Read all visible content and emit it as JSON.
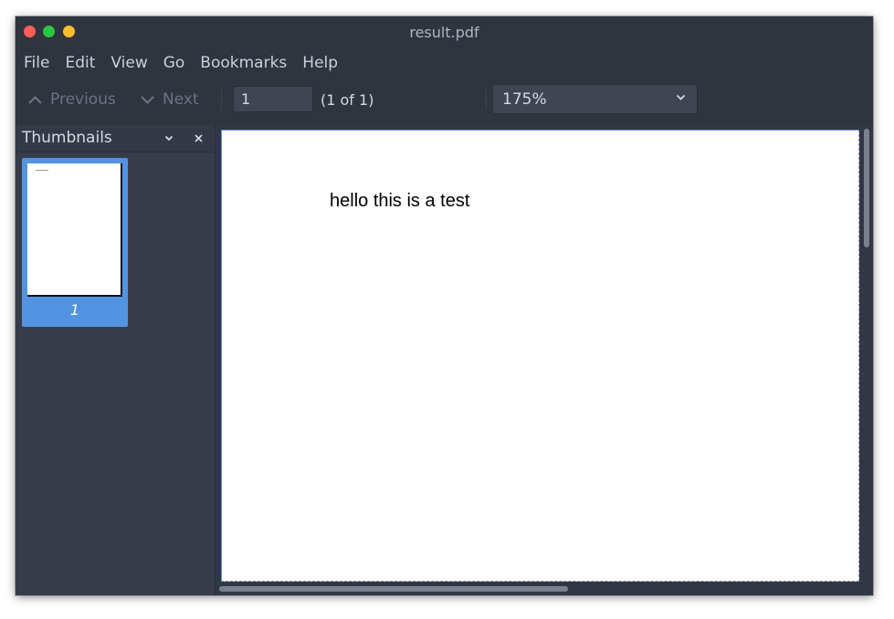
{
  "window": {
    "title": "result.pdf"
  },
  "menu": [
    "File",
    "Edit",
    "View",
    "Go",
    "Bookmarks",
    "Help"
  ],
  "toolbar": {
    "previous_label": "Previous",
    "next_label": "Next",
    "page_value": "1",
    "page_count": "(1 of 1)",
    "zoom_value": "175%"
  },
  "sidebar": {
    "title": "Thumbnails",
    "thumbnails": [
      {
        "label": "1"
      }
    ]
  },
  "document": {
    "text": "hello this is a test"
  },
  "colors": {
    "window_bg": "#2f343f",
    "accent": "#5294e2",
    "close": "#ff5f57",
    "minimize": "#28c840",
    "maximize": "#febc2e"
  },
  "icons": [
    "chevron-up-icon",
    "chevron-down-icon",
    "close-icon"
  ]
}
